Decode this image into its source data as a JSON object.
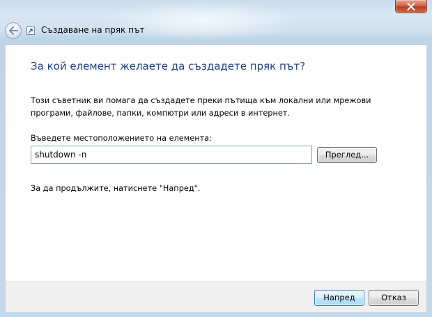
{
  "window": {
    "title": "Създаване на пряк път",
    "close_icon": "close-icon",
    "back_icon": "back-arrow-icon"
  },
  "wizard": {
    "heading": "За кой елемент желаете да създадете пряк път?",
    "description": "Този съветник ви помага да създадете преки пътища към локални или мрежови програми, файлове, папки, компютри или адреси в интернет.",
    "location_label": "Въведете местоположението на елемента:",
    "location_value": "shutdown -n",
    "browse_label": "Преглед...",
    "hint": "За да продължите, натиснете \"Напред\"."
  },
  "footer": {
    "next_label": "Напред",
    "cancel_label": "Отказ"
  },
  "colors": {
    "heading": "#1f3f8a",
    "close_button": "#c1391c",
    "frame": "#c6d9ea"
  }
}
